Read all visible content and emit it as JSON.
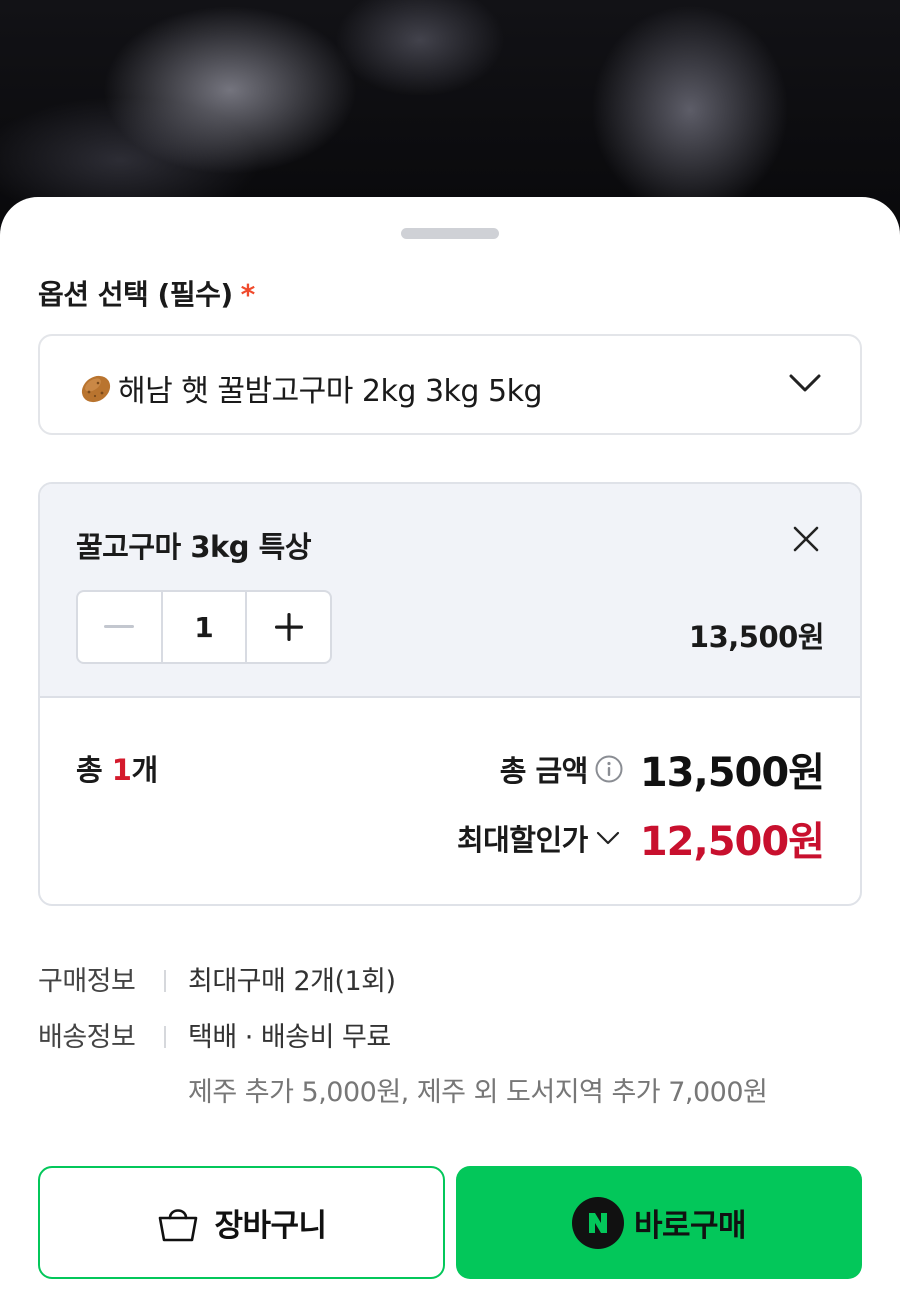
{
  "option": {
    "title": "옵션 선택 (필수)",
    "required_mark": "*",
    "selected_product": "해남 햇 꿀밤고구마 2kg 3kg 5kg",
    "selected_icon": "potato-icon"
  },
  "selected_item": {
    "name": "꿀고구마 3kg 특상",
    "quantity": "1",
    "price": "13,500원"
  },
  "summary": {
    "count_prefix": "총 ",
    "count_value": "1",
    "count_suffix": "개",
    "total_label": "총 금액",
    "total_amount": "13,500원",
    "discount_label": "최대할인가",
    "discount_amount": "12,500원"
  },
  "purchase_info": {
    "label": "구매정보",
    "value": "최대구매 2개(1회)"
  },
  "shipping_info": {
    "label": "배송정보",
    "value": "택배 · 배송비 무료",
    "note": "제주 추가 5,000원, 제주 외 도서지역 추가 7,000원"
  },
  "buttons": {
    "cart_label": "장바구니",
    "buy_label": "바로구매",
    "buy_badge": "N"
  },
  "colors": {
    "accent_green": "#03c75a",
    "discount_red": "#c8102e",
    "required_red": "#f04a2c"
  }
}
